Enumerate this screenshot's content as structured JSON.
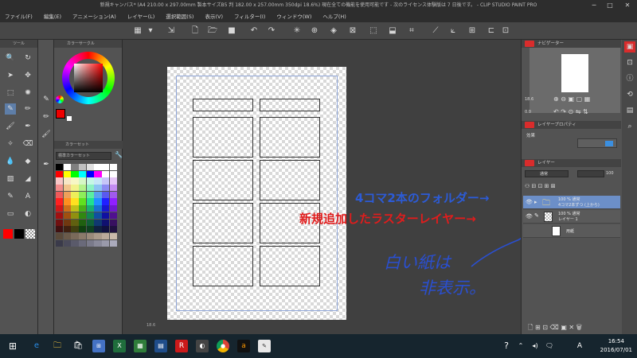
{
  "window": {
    "title": "新規キャンバス* (A4 210.00 x 297.00mm 製本サイズB5 判 182.00 x 257.00mm 350dpi 18.6%)  現在全ての機能を使用可能です - 次のライセンス体験版は 7 日後です。 - CLIP STUDIO PAINT PRO",
    "minimize": "─",
    "maximize": "□",
    "close": "✕"
  },
  "menu": [
    "ファイル(F)",
    "編集(E)",
    "アニメーション(A)",
    "レイヤー(L)",
    "選択範囲(S)",
    "表示(V)",
    "フィルター(I)",
    "ウィンドウ(W)",
    "ヘルプ(H)"
  ],
  "tool_panel": {
    "label": "ツール"
  },
  "color_panel": {
    "wheel_label": "カラーサークル",
    "set_label": "カラーセット",
    "set_select": "標準カラーセット",
    "swatches": [
      "#000000",
      "#ffffff",
      "#7f7f7f",
      "#c0c0c0",
      "#e0e0e0",
      "#ffffff",
      "#ffffff",
      "#ffffff",
      "#ff0000",
      "#ffff00",
      "#00ff00",
      "#00ffff",
      "#0000ff",
      "#ff00ff",
      "#ffffff",
      "#ffffff",
      "#f7c6c6",
      "#f7e6c6",
      "#f7f7c6",
      "#d6f7c6",
      "#c6f7e6",
      "#c6e6f7",
      "#c6c6f7",
      "#e6c6f7",
      "#f28c8c",
      "#f2c48c",
      "#f2f28c",
      "#b4f28c",
      "#8cf2c4",
      "#8cc4f2",
      "#8c8cf2",
      "#c48cf2",
      "#ee5a5a",
      "#eea05a",
      "#eeee5a",
      "#8eee5a",
      "#5aeea0",
      "#5aa0ee",
      "#5a5aee",
      "#a05aee",
      "#ff2020",
      "#ff9020",
      "#ffe020",
      "#60e020",
      "#20e090",
      "#2090ff",
      "#2020ff",
      "#9020ff",
      "#d01818",
      "#d07018",
      "#c0c018",
      "#48b018",
      "#18b070",
      "#1870d0",
      "#1818d0",
      "#7018d0",
      "#a01010",
      "#a05010",
      "#909010",
      "#308810",
      "#108850",
      "#1050a0",
      "#1010a0",
      "#501090",
      "#701010",
      "#703810",
      "#606010",
      "#206010",
      "#106038",
      "#103870",
      "#101070",
      "#381060",
      "#401010",
      "#402010",
      "#404010",
      "#104010",
      "#104020",
      "#102040",
      "#101040",
      "#201040",
      "#5a4a3a",
      "#6a5a4a",
      "#7a6a5a",
      "#8a7a6a",
      "#9a8a7a",
      "#aa9a8a",
      "#baaa9a",
      "#cabaaa",
      "#3a3a4a",
      "#4a4a5a",
      "#5a5a6a",
      "#6a6a7a",
      "#7a7a8a",
      "#8a8a9a",
      "#9a9aaa",
      "#aaaabb"
    ]
  },
  "annotations": {
    "folder": "4コマ2本のフォルダー→",
    "raster": "新規追加したラスターレイヤー→",
    "handwritten_line1": "白い紙は",
    "handwritten_line2": "非表示。"
  },
  "right_panel": {
    "navigator_label": "ナビゲーター",
    "zoom": "18.6",
    "rotation": "0.0",
    "layer_property_label": "レイヤープロパティ",
    "effect_label": "効果",
    "layer_label": "レイヤー",
    "blend_mode": "通常",
    "opacity": "100",
    "layers": [
      {
        "line1": "100 % 通常",
        "line2": "4コマ2本ずつ (上から)",
        "type": "folder"
      },
      {
        "line1": "100 % 通常",
        "line2": "レイヤー 1",
        "type": "raster"
      },
      {
        "line1": "",
        "line2": "用紙",
        "type": "paper"
      }
    ]
  },
  "canvas": {
    "zoom_readout": "18.6"
  },
  "taskbar": {
    "time": "16:54",
    "date": "2016/07/01",
    "ime": "A",
    "apps": [
      "edge",
      "folder",
      "store",
      "calc",
      "excel",
      "sheet",
      "r-app",
      "game",
      "chrome",
      "amazon",
      "clipstudio"
    ]
  },
  "colors": {
    "accent": "#6c8fc8",
    "brand_red": "#d92c2c",
    "annot_blue": "#2c5bd6",
    "annot_red": "#e11c1c"
  }
}
